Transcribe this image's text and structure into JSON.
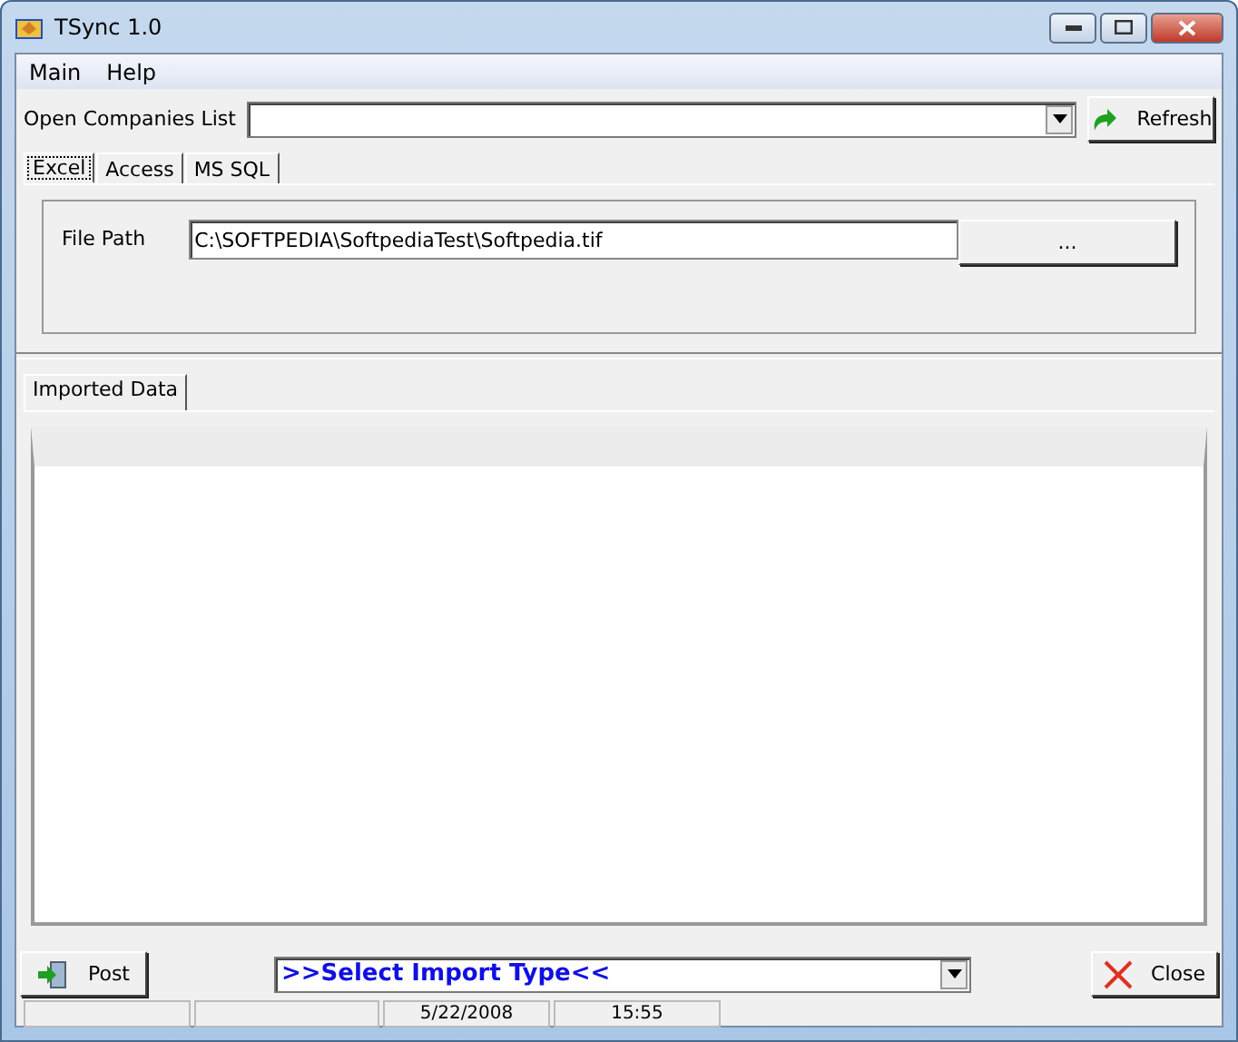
{
  "window": {
    "title": "TSync 1.0"
  },
  "menu": [
    "Main",
    "Help"
  ],
  "companies": {
    "label": "Open Companies List",
    "refresh": "Refresh"
  },
  "source_tabs": [
    {
      "label": "Excel",
      "selected": true
    },
    {
      "label": "Access",
      "selected": false
    },
    {
      "label": "MS SQL",
      "selected": false
    }
  ],
  "file_path": {
    "label": "File Path",
    "value": "C:\\SOFTPEDIA\\SoftpediaTest\\Softpedia.tif",
    "browse": "..."
  },
  "data_tabs": [
    {
      "label": "Imported Data",
      "selected": true
    }
  ],
  "bottom": {
    "post": "Post",
    "import_type": ">>Select Import Type<<",
    "close": "Close"
  },
  "status_bar": [
    "5/22/2008",
    "15:55"
  ]
}
